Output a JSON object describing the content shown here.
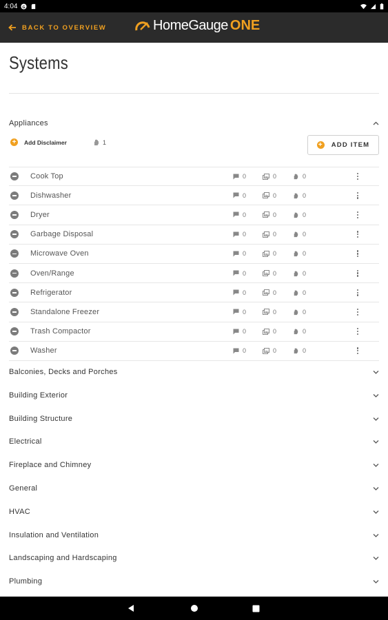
{
  "status_bar": {
    "time": "4:04"
  },
  "app_bar": {
    "back_label": "BACK TO OVERVIEW",
    "logo_text": "HomeGauge",
    "logo_suffix": "ONE"
  },
  "page": {
    "title": "Systems"
  },
  "appliances": {
    "title": "Appliances",
    "disclaimer_label": "Add Disclaimer",
    "disclaimer_count": "1",
    "add_item_label": "ADD ITEM",
    "items": [
      {
        "name": "Cook Top",
        "comments": "0",
        "photos": "0",
        "defects": "0"
      },
      {
        "name": "Dishwasher",
        "comments": "0",
        "photos": "0",
        "defects": "0"
      },
      {
        "name": "Dryer",
        "comments": "0",
        "photos": "0",
        "defects": "0"
      },
      {
        "name": "Garbage Disposal",
        "comments": "0",
        "photos": "0",
        "defects": "0"
      },
      {
        "name": "Microwave Oven",
        "comments": "0",
        "photos": "0",
        "defects": "0"
      },
      {
        "name": "Oven/Range",
        "comments": "0",
        "photos": "0",
        "defects": "0"
      },
      {
        "name": "Refrigerator",
        "comments": "0",
        "photos": "0",
        "defects": "0"
      },
      {
        "name": "Standalone Freezer",
        "comments": "0",
        "photos": "0",
        "defects": "0"
      },
      {
        "name": "Trash Compactor",
        "comments": "0",
        "photos": "0",
        "defects": "0"
      },
      {
        "name": "Washer",
        "comments": "0",
        "photos": "0",
        "defects": "0"
      }
    ]
  },
  "sections": [
    "Balconies, Decks and Porches",
    "Building Exterior",
    "Building Structure",
    "Electrical",
    "Fireplace and Chimney",
    "General",
    "HVAC",
    "Insulation and Ventilation",
    "Landscaping and Hardscaping",
    "Plumbing"
  ],
  "colors": {
    "accent": "#f0a020",
    "appbar": "#2b2b2b"
  },
  "icons": {
    "back": "arrow-left-icon",
    "expand": "chevron-down-icon",
    "collapse": "chevron-up-icon",
    "comments": "comment-icon",
    "photos": "photos-icon",
    "defects": "hand-icon",
    "remove": "minus-circle-icon",
    "more": "kebab-icon"
  }
}
